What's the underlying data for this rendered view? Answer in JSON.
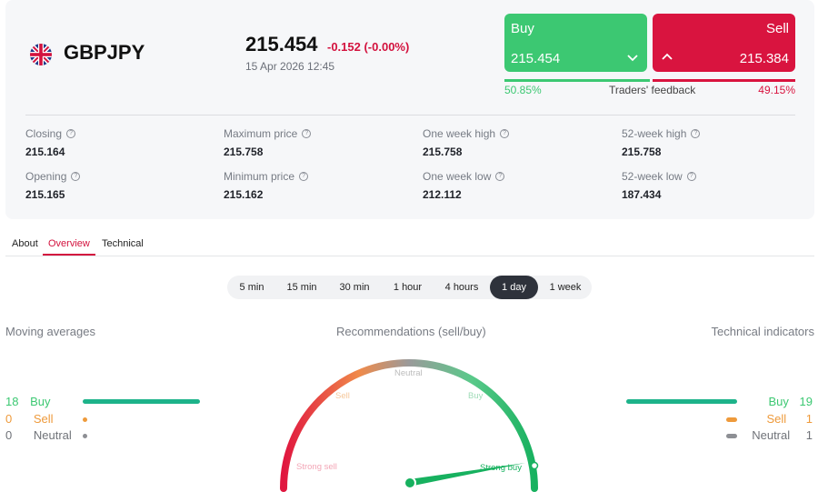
{
  "instrument": {
    "symbol": "GBPJPY",
    "price": "215.454",
    "change": "-0.152 (-0.00%)",
    "datetime": "15 Apr 2026 12:45",
    "flag_icon": "uk-flag-icon"
  },
  "trade": {
    "buy_label": "Buy",
    "buy_price": "215.454",
    "sell_label": "Sell",
    "sell_price": "215.384",
    "feedback_label": "Traders' feedback",
    "buy_pct": "50.85%",
    "sell_pct": "49.15%",
    "buy_share": 0.5085
  },
  "stats": [
    {
      "label": "Closing",
      "value": "215.164"
    },
    {
      "label": "Maximum price",
      "value": "215.758"
    },
    {
      "label": "One week high",
      "value": "215.758"
    },
    {
      "label": "52-week high",
      "value": "215.758"
    },
    {
      "label": "Opening",
      "value": "215.165"
    },
    {
      "label": "Minimum price",
      "value": "215.162"
    },
    {
      "label": "One week low",
      "value": "212.112"
    },
    {
      "label": "52-week low",
      "value": "187.434"
    }
  ],
  "tabs": [
    {
      "label": "About"
    },
    {
      "label": "Overview",
      "active": true
    },
    {
      "label": "Technical"
    }
  ],
  "periods": [
    {
      "label": "5 min"
    },
    {
      "label": "15 min"
    },
    {
      "label": "30 min"
    },
    {
      "label": "1 hour"
    },
    {
      "label": "4 hours"
    },
    {
      "label": "1 day",
      "active": true
    },
    {
      "label": "1 week"
    }
  ],
  "moving_averages": {
    "title": "Moving averages",
    "buy": {
      "count": "18",
      "label": "Buy"
    },
    "sell": {
      "count": "0",
      "label": "Sell"
    },
    "neutral": {
      "count": "0",
      "label": "Neutral"
    }
  },
  "recommendations": {
    "title": "Recommendations (sell/buy)",
    "labels": {
      "strong_sell": "Strong sell",
      "sell": "Sell",
      "neutral": "Neutral",
      "buy": "Buy",
      "strong_buy": "Strong buy"
    },
    "needle_value": "Strong buy"
  },
  "technical_indicators": {
    "title": "Technical indicators",
    "buy": {
      "count": "19",
      "label": "Buy"
    },
    "sell": {
      "count": "1",
      "label": "Sell"
    },
    "neutral": {
      "count": "1",
      "label": "Neutral"
    }
  },
  "colors": {
    "buy": "#3cc872",
    "sell": "#d9143f",
    "accent": "#d3123e",
    "ma_bar": "#1db38a",
    "sell_orange": "#ee9a3b",
    "neutral_gray": "#8d8f94"
  }
}
